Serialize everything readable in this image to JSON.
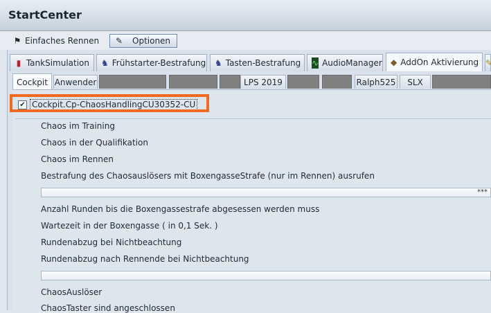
{
  "window": {
    "title": "StartCenter"
  },
  "modes": [
    {
      "label": "Einfaches Rennen",
      "icon": "race-flag-icon"
    },
    {
      "label": "Optionen",
      "icon": "tools-icon"
    }
  ],
  "main_tabs": [
    {
      "label": "TankSimulation",
      "icon": "fuel-icon"
    },
    {
      "label": "Frühstarter-Bestrafung",
      "icon": "police-car-icon"
    },
    {
      "label": "Tasten-Bestrafung",
      "icon": "police-car-icon"
    },
    {
      "label": "AudioManager",
      "icon": "audio-wave-icon"
    },
    {
      "label": "AddOn Aktivierung",
      "icon": "cube-icon"
    }
  ],
  "sub_tabs": [
    {
      "label": "Cockpit"
    },
    {
      "label": "Anwender"
    },
    {
      "label": ""
    },
    {
      "label": ""
    },
    {
      "label": ""
    },
    {
      "label": "LPS 2019"
    },
    {
      "label": ""
    },
    {
      "label": ""
    },
    {
      "label": "Ralph525"
    },
    {
      "label": "SLX"
    },
    {
      "label": ""
    }
  ],
  "addon": {
    "label": "Cockpit.Cp-ChaosHandlingCU30352-CU",
    "checked": true
  },
  "settings": {
    "chaos_training": "Chaos im Training",
    "chaos_quali": "Chaos in der Qualifikation",
    "chaos_race": "Chaos im Rennen",
    "penalty_label": "Bestrafung des Chaosauslösers mit BoxengasseStrafe (nur im Rennen) ausrufen",
    "penalty_value": "***",
    "laps_label": "Anzahl Runden bis die Boxengassestrafe abgesessen werden muss",
    "wait_label": "Wartezeit in der Boxengasse  ( in 0,1 Sek. )",
    "deduct_label": "Rundenabzug bei Nichtbeachtung",
    "deduct_end_label": "Rundenabzug nach Rennende bei Nichtbeachtung",
    "trigger_label": "ChaosAuslöser",
    "buttons_label": "ChaosTaster sind angeschlossen"
  }
}
